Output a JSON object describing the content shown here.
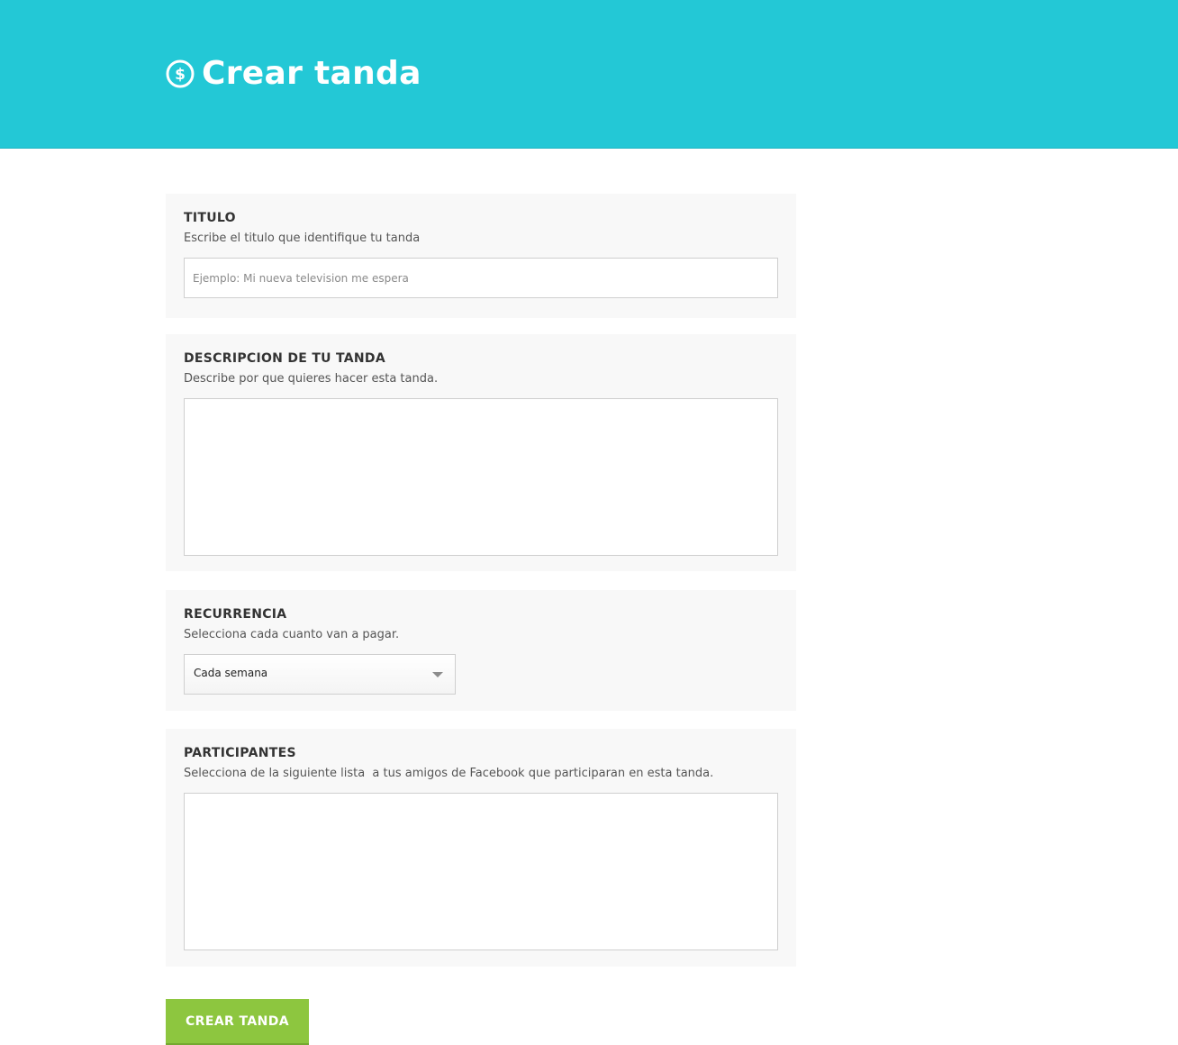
{
  "header": {
    "title": "Crear tanda",
    "icon": "dollar-circle-icon",
    "background_color": "#23c8d6"
  },
  "form": {
    "titulo": {
      "label": "TITULO",
      "help": "Escribe el titulo que identifique tu tanda",
      "placeholder": "Ejemplo: Mi nueva television me espera",
      "value": ""
    },
    "descripcion": {
      "label": "DESCRIPCION DE TU TANDA",
      "help": "Describe por que quieres hacer esta tanda.",
      "value": ""
    },
    "recurrencia": {
      "label": "RECURRENCIA",
      "help": "Selecciona cada cuanto van a pagar.",
      "selected": "Cada semana"
    },
    "participantes": {
      "label": "PARTICIPANTES",
      "help": "Selecciona de la siguiente lista  a tus amigos de Facebook que participaran en esta tanda."
    }
  },
  "submit": {
    "label": "CREAR TANDA",
    "color": "#8dc63f"
  }
}
